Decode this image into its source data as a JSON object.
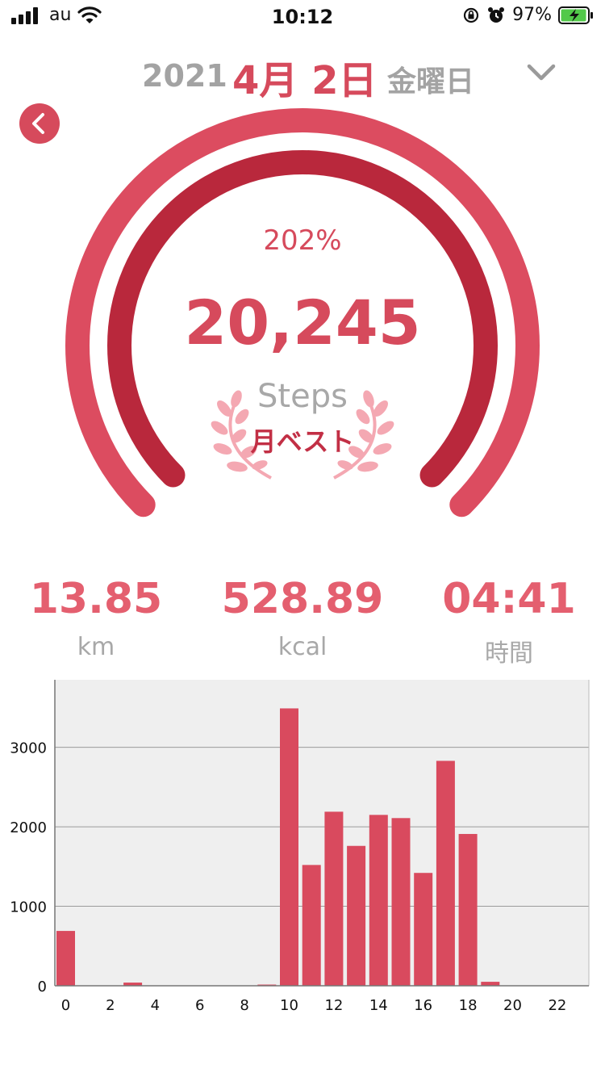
{
  "status_bar": {
    "carrier": "au",
    "time": "10:12",
    "battery_pct": "97%",
    "battery_level": 0.97,
    "signal_bars": 4
  },
  "header": {
    "year": "2021",
    "date": "4月 2日",
    "weekday": "金曜日"
  },
  "gauge": {
    "percent": "202%",
    "steps": "20,245",
    "unit": "Steps",
    "badge": "月ベスト",
    "outer_progress": 1.0,
    "inner_progress": 1.0
  },
  "stats": [
    {
      "value": "13.85",
      "label": "km"
    },
    {
      "value": "528.89",
      "label": "kcal"
    },
    {
      "value": "04:41",
      "label": "時間"
    }
  ],
  "colors": {
    "accent": "#d64a5c",
    "outer_ring": "#dc4c60",
    "inner_ring": "#b9283c",
    "bar": "#d94a5e",
    "gray_text": "#a8a8a8",
    "chart_bg": "#efefef"
  },
  "chart_data": {
    "type": "bar",
    "x": [
      0,
      1,
      2,
      3,
      4,
      5,
      6,
      7,
      8,
      9,
      10,
      11,
      12,
      13,
      14,
      15,
      16,
      17,
      18,
      19,
      20,
      21,
      22,
      23
    ],
    "values": [
      690,
      0,
      0,
      40,
      0,
      0,
      0,
      0,
      0,
      15,
      3490,
      1520,
      2190,
      1760,
      2150,
      2110,
      1420,
      2830,
      1910,
      50,
      0,
      0,
      0,
      0
    ],
    "xticks": [
      "0",
      "2",
      "4",
      "6",
      "8",
      "10",
      "12",
      "14",
      "16",
      "18",
      "20",
      "22"
    ],
    "yticks": [
      "0",
      "1000",
      "2000",
      "3000"
    ],
    "ylim": [
      0,
      3850
    ],
    "title": "",
    "xlabel": "",
    "ylabel": "",
    "grid": true
  }
}
